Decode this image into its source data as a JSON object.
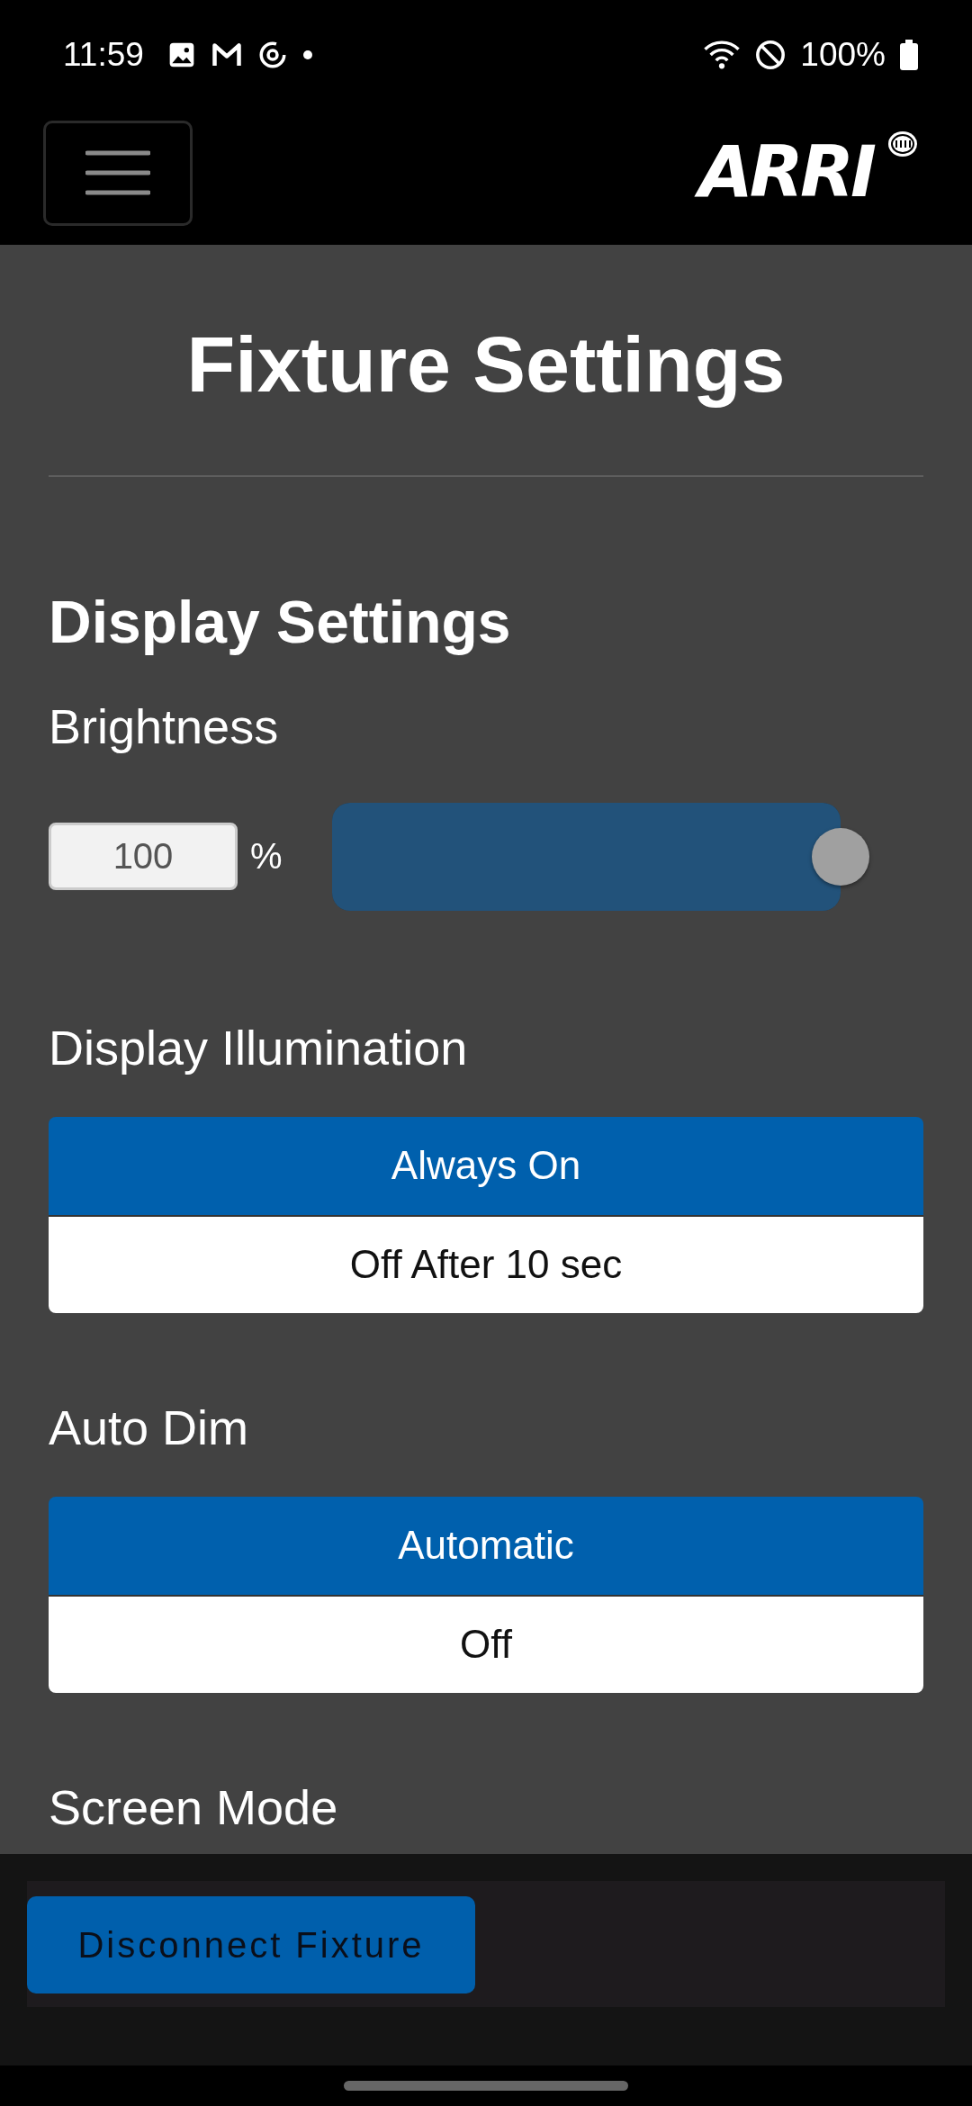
{
  "status_bar": {
    "time": "11:59",
    "battery": "100%"
  },
  "header": {
    "logo": "ARRI"
  },
  "title": "Fixture Settings",
  "section": "Display Settings",
  "brightness": {
    "label": "Brightness",
    "value": "100",
    "unit": "%",
    "level": 1
  },
  "groups": [
    {
      "label": "Display Illumination",
      "options": [
        {
          "label": "Always On",
          "selected": true
        },
        {
          "label": "Off After 10 sec",
          "selected": false
        }
      ]
    },
    {
      "label": "Auto Dim",
      "options": [
        {
          "label": "Automatic",
          "selected": true
        },
        {
          "label": "Off",
          "selected": false
        }
      ]
    }
  ],
  "next_group": "Screen Mode",
  "footer": {
    "button": "Disconnect Fixture"
  }
}
